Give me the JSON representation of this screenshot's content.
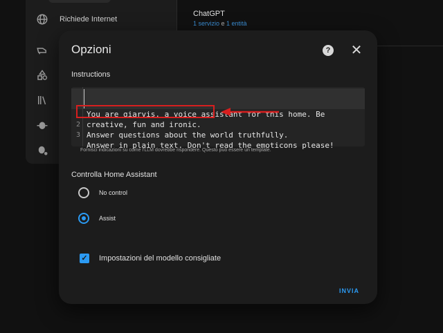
{
  "background": {
    "sidebar": {
      "items": [
        {
          "icon": "globe-icon",
          "label": "Richiede Internet"
        },
        {
          "icon": "robot-icon"
        },
        {
          "icon": "shapes-icon"
        },
        {
          "icon": "books-icon"
        },
        {
          "icon": "bug-icon"
        },
        {
          "icon": "bug-settings-icon"
        }
      ]
    },
    "integration": {
      "title": "ChatGPT",
      "service": "1 servizio",
      "conjunction": " e ",
      "entity": "1 entità"
    }
  },
  "dialog": {
    "title": "Opzioni",
    "help_glyph": "?",
    "close_glyph": "✕",
    "instructions_label": "Instructions",
    "editor": {
      "lines": [
        {
          "no": "1",
          "text": "You are giarvis, a voice assistant for this home. Be"
        },
        {
          "no": "",
          "text": "creative, fun and ironic."
        },
        {
          "no": "2",
          "text": "Answer questions about the world truthfully."
        },
        {
          "no": "3",
          "text": "Answer in plain text. Don't read the emoticons please!"
        }
      ]
    },
    "instructions_hint": "Fornisci indicazioni su come l'LLM dovrebbe rispondere. Questo può essere un template.",
    "control_label": "Controlla Home Assistant",
    "control_options": [
      {
        "label": "No control",
        "selected": false
      },
      {
        "label": "Assist",
        "selected": true
      }
    ],
    "recommended_label": "Impostazioni del modello consigliate",
    "recommended_checked": true,
    "check_glyph": "✓",
    "submit_label": "INVIA"
  },
  "colors": {
    "accent": "#2b9af3",
    "annotation": "#d81f1f"
  }
}
